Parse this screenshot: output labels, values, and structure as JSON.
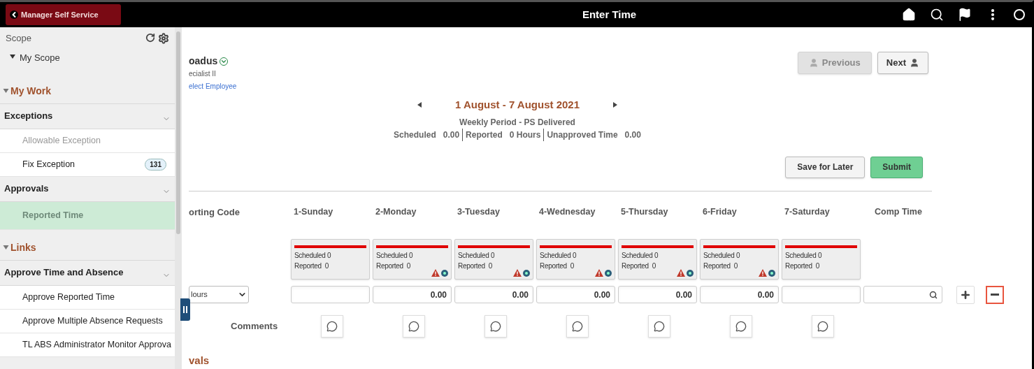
{
  "header": {
    "back_button": "Manager Self Service",
    "title": "Enter Time"
  },
  "sidebar": {
    "scope_label": "Scope",
    "scope_item": "My Scope",
    "sections": [
      {
        "title": "My Work",
        "expanded": true,
        "groups": [
          {
            "title": "Exceptions",
            "items": [
              {
                "label": "Allowable Exception",
                "selected": false,
                "disabled": true
              },
              {
                "label": "Fix Exception",
                "selected": false,
                "disabled": false,
                "badge": "131"
              }
            ]
          },
          {
            "title": "Approvals",
            "items": [
              {
                "label": "Reported Time",
                "selected": true,
                "disabled": false
              }
            ]
          }
        ]
      },
      {
        "title": "Links",
        "expanded": true,
        "groups": [
          {
            "title": "Approve Time and Absence",
            "items": [
              {
                "label": "Approve Reported Time",
                "selected": false,
                "disabled": false
              },
              {
                "label": "Approve Multiple Absence Requests",
                "selected": false,
                "disabled": false
              },
              {
                "label": "TL ABS Administrator Monitor Approva",
                "selected": false,
                "disabled": false
              }
            ]
          }
        ]
      }
    ]
  },
  "employee": {
    "name": "oadus",
    "job_title": "ecialist II",
    "select_link": "elect Employee"
  },
  "employee_nav": [
    {
      "label": "Previous",
      "kind": "previous",
      "disabled": true
    },
    {
      "label": "Next",
      "kind": "next",
      "disabled": false
    }
  ],
  "period": {
    "title": "1 August - 7 August 2021",
    "subtitle": "Weekly Period - PS Delivered",
    "summary": [
      {
        "label": "Scheduled",
        "value": "0.00"
      },
      {
        "label": "Reported",
        "value": "0 Hours"
      },
      {
        "label": "Unapproved Time",
        "value": "0.00"
      }
    ]
  },
  "actions": [
    {
      "label": "Save for Later",
      "kind": "secondary"
    },
    {
      "label": "Submit",
      "kind": "primary"
    }
  ],
  "grid": {
    "code_column": "orting Code",
    "comp_column": "Comp Time",
    "code_value": "lours",
    "comments_label": "Comments",
    "days": [
      {
        "label": "1-Sunday",
        "scheduled": "Scheduled 0",
        "reported": "Reported  0",
        "warning": false
      },
      {
        "label": "2-Monday",
        "scheduled": "Scheduled 0",
        "reported": "Reported  0",
        "warning": true,
        "hours": "0.00"
      },
      {
        "label": "3-Tuesday",
        "scheduled": "Scheduled 0",
        "reported": "Reported  0",
        "warning": true,
        "hours": "0.00"
      },
      {
        "label": "4-Wednesday",
        "scheduled": "Scheduled 0",
        "reported": "Reported  0",
        "warning": true,
        "hours": "0.00"
      },
      {
        "label": "5-Thursday",
        "scheduled": "Scheduled 0",
        "reported": "Reported  0",
        "warning": true,
        "hours": "0.00"
      },
      {
        "label": "6-Friday",
        "scheduled": "Scheduled 0",
        "reported": "Reported  0",
        "warning": true,
        "hours": "0.00"
      },
      {
        "label": "7-Saturday",
        "scheduled": "Scheduled 0",
        "reported": "Reported  0",
        "warning": false
      }
    ]
  },
  "next_section": "vals"
}
